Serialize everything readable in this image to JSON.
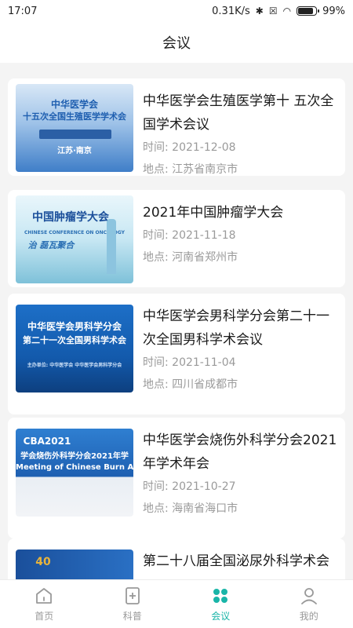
{
  "status": {
    "time": "17:07",
    "speed": "0.31K/s",
    "battery": "99%"
  },
  "header": {
    "title": "会议"
  },
  "meetings": [
    {
      "title": "中华医学会生殖医学第十 五次全国学术会议",
      "time": "时间: 2021-12-08",
      "place": "地点: 江苏省南京市",
      "thumb": {
        "line1": "中华医学会",
        "line2": "十五次全国生殖医学学术会",
        "line3": "江苏·南京"
      }
    },
    {
      "title": "2021年中国肿瘤学大会",
      "time": "时间: 2021-11-18",
      "place": "地点: 河南省郑州市",
      "thumb": {
        "line1": "中国肿瘤学大会",
        "line2": "CHINESE CONFERENCE ON ONCOLOGY",
        "line3": "治 磊瓦聚合"
      }
    },
    {
      "title": "中华医学会男科学分会第二十一次全国男科学术会议",
      "time": "时间: 2021-11-04",
      "place": "地点: 四川省成都市",
      "thumb": {
        "line1": "中华医学会男科学分会",
        "line2": "第二十一次全国男科学术会",
        "line3": "主办单位: 中华医学会 中华医学会男科学分会"
      }
    },
    {
      "title": "中华医学会烧伤外科学分会2021年学术年会",
      "time": "时间: 2021-10-27",
      "place": "地点: 海南省海口市",
      "thumb": {
        "line1": "CBA2021",
        "line2": "学会烧伤外科学分会2021年学",
        "line3": "Meeting of Chinese Burn Associa"
      }
    },
    {
      "title": "第二十八届全国泌尿外科学术会",
      "time": "",
      "place": "",
      "thumb": {
        "line1": "40",
        "line2": "",
        "line3": ""
      }
    }
  ],
  "tabs": [
    {
      "label": "首页",
      "icon": "home-icon"
    },
    {
      "label": "科普",
      "icon": "science-icon"
    },
    {
      "label": "会议",
      "icon": "meeting-icon"
    },
    {
      "label": "我的",
      "icon": "profile-icon"
    }
  ],
  "colors": {
    "accent": "#19b5a8",
    "inactive": "#999999"
  }
}
